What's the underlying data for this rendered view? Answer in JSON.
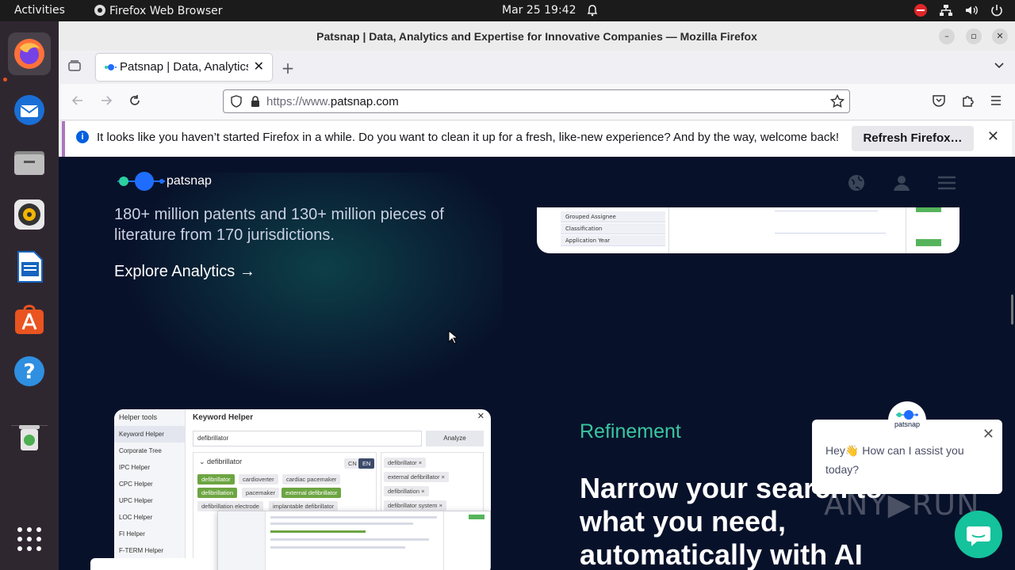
{
  "system": {
    "activities": "Activities",
    "app_name": "Firefox Web Browser",
    "clock": "Mar 25  19:42"
  },
  "window": {
    "title": "Patsnap | Data, Analytics and Expertise for Innovative Companies — Mozilla Firefox"
  },
  "tab": {
    "label": "Patsnap | Data, Analytics and Expertise for Innovative Companies"
  },
  "url": {
    "prefix": "https://www.",
    "domain": "patsnap.com"
  },
  "notification": {
    "message": "It looks like you haven’t started Firefox in a while. Do you want to clean it up for a fresh, like-new experience? And by the way, welcome back!",
    "button": "Refresh Firefox…"
  },
  "site": {
    "logo_text": "patsnap",
    "hero_text": "180+ million patents and 130+ million pieces of literature from 170 jurisdictions.",
    "explore": "Explore Analytics →",
    "card1_rows": [
      "Grouped Assignee",
      "Classification",
      "Application Year"
    ],
    "card2": {
      "title": "Keyword Helper",
      "helper_tools": "Helper tools",
      "side": [
        "Keyword Helper",
        "Corporate Tree",
        "IPC Helper",
        "CPC Helper",
        "UPC Helper",
        "LOC Helper",
        "FI Helper",
        "F-TERM Helper"
      ],
      "search_value": "defibrillator",
      "analyze": "Analyze",
      "group": "defibrillator",
      "lang_cn": "CN",
      "lang_en": "EN",
      "chips": [
        "defibrillator",
        "cardioverter",
        "cardiac pacemaker",
        "defibrillation",
        "pacemaker",
        "external defibrillator",
        "defibrillation electrode",
        "implantable defibrillator"
      ],
      "selected": [
        "defibrillator ×",
        "external defibrillator ×",
        "defibrillation ×",
        "defibrillator system ×"
      ]
    },
    "refine_label": "Refinement",
    "headline": "Narrow your search to what you need, automatically with AI",
    "chat_message": "Hey👋 How can I assist you today?",
    "chat_brand": "patsnap"
  },
  "colors": {
    "page_bg": "#08112a",
    "accent_green": "#39c6a0",
    "chat_fab": "#14c29c"
  }
}
